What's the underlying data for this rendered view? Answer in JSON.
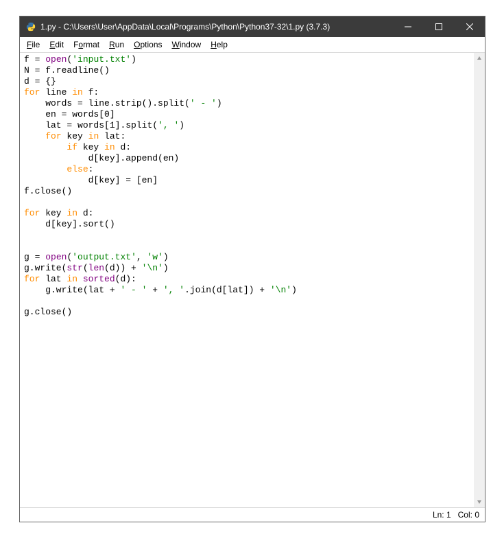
{
  "window": {
    "title": "1.py - C:\\Users\\User\\AppData\\Local\\Programs\\Python\\Python37-32\\1.py (3.7.3)"
  },
  "menu": {
    "file": "File",
    "edit": "Edit",
    "format": "Format",
    "run": "Run",
    "options": "Options",
    "window": "Window",
    "help": "Help"
  },
  "code": {
    "tokens": [
      [
        [
          "f = ",
          ""
        ],
        [
          "open",
          "bi"
        ],
        [
          "(",
          ""
        ],
        [
          "'input.txt'",
          "str"
        ],
        [
          ")",
          ""
        ]
      ],
      [
        [
          "N = f.readline()",
          ""
        ]
      ],
      [
        [
          "d = {}",
          ""
        ]
      ],
      [
        [
          "for",
          "kw"
        ],
        [
          " line ",
          ""
        ],
        [
          "in",
          "kw"
        ],
        [
          " f:",
          ""
        ]
      ],
      [
        [
          "    words = line.strip().split(",
          ""
        ],
        [
          "' - '",
          "str"
        ],
        [
          ")",
          ""
        ]
      ],
      [
        [
          "    en = words[",
          ""
        ],
        [
          "0",
          "op"
        ],
        [
          "]",
          ""
        ]
      ],
      [
        [
          "    lat = words[",
          ""
        ],
        [
          "1",
          "op"
        ],
        [
          "].split(",
          ""
        ],
        [
          "', '",
          "str"
        ],
        [
          ")",
          ""
        ]
      ],
      [
        [
          "    ",
          ""
        ],
        [
          "for",
          "kw"
        ],
        [
          " key ",
          ""
        ],
        [
          "in",
          "kw"
        ],
        [
          " lat:",
          ""
        ]
      ],
      [
        [
          "        ",
          ""
        ],
        [
          "if",
          "kw"
        ],
        [
          " key ",
          ""
        ],
        [
          "in",
          "kw"
        ],
        [
          " d:",
          ""
        ]
      ],
      [
        [
          "            d[key].append(en)",
          ""
        ]
      ],
      [
        [
          "        ",
          ""
        ],
        [
          "else",
          "kw"
        ],
        [
          ":",
          ""
        ]
      ],
      [
        [
          "            d[key] = [en]",
          ""
        ]
      ],
      [
        [
          "f.close()",
          ""
        ]
      ],
      [
        [
          "",
          ""
        ]
      ],
      [
        [
          "for",
          "kw"
        ],
        [
          " key ",
          ""
        ],
        [
          "in",
          "kw"
        ],
        [
          " d:",
          ""
        ]
      ],
      [
        [
          "    d[key].sort()",
          ""
        ]
      ],
      [
        [
          "",
          ""
        ]
      ],
      [
        [
          "",
          ""
        ]
      ],
      [
        [
          "g = ",
          ""
        ],
        [
          "open",
          "bi"
        ],
        [
          "(",
          ""
        ],
        [
          "'output.txt'",
          "str"
        ],
        [
          ", ",
          ""
        ],
        [
          "'w'",
          "str"
        ],
        [
          ")",
          ""
        ]
      ],
      [
        [
          "g.write(",
          ""
        ],
        [
          "str",
          "bi"
        ],
        [
          "(",
          ""
        ],
        [
          "len",
          "bi"
        ],
        [
          "(d)) + ",
          ""
        ],
        [
          "'\\n'",
          "str"
        ],
        [
          ")",
          ""
        ]
      ],
      [
        [
          "for",
          "kw"
        ],
        [
          " lat ",
          ""
        ],
        [
          "in",
          "kw"
        ],
        [
          " ",
          ""
        ],
        [
          "sorted",
          "bi"
        ],
        [
          "(d):",
          ""
        ]
      ],
      [
        [
          "    g.write(lat + ",
          ""
        ],
        [
          "' - '",
          "str"
        ],
        [
          " + ",
          ""
        ],
        [
          "', '",
          "str"
        ],
        [
          ".join(d[lat]) + ",
          ""
        ],
        [
          "'\\n'",
          "str"
        ],
        [
          ")",
          ""
        ]
      ],
      [
        [
          "",
          ""
        ]
      ],
      [
        [
          "g.close()",
          ""
        ]
      ]
    ]
  },
  "status": {
    "ln": "Ln: 1",
    "col": "Col: 0"
  }
}
